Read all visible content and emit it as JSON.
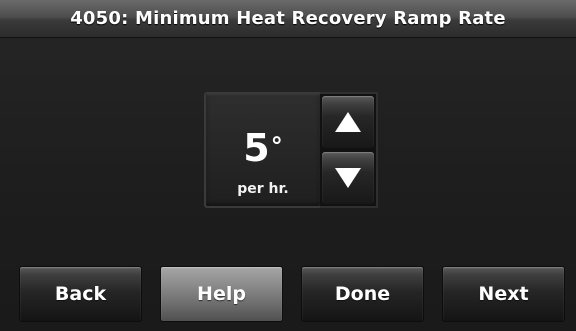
{
  "header": {
    "title": "4050: Minimum Heat Recovery Ramp Rate"
  },
  "setting": {
    "value": "5",
    "degree_symbol": "°",
    "unit": "per hr."
  },
  "controls": {
    "increase_icon": "triangle-up-icon",
    "decrease_icon": "triangle-down-icon"
  },
  "footer": {
    "back_label": "Back",
    "help_label": "Help",
    "done_label": "Done",
    "next_label": "Next"
  },
  "colors": {
    "background": "#1c1c1c",
    "text": "#ffffff",
    "help_button": "#8e8e8e"
  }
}
